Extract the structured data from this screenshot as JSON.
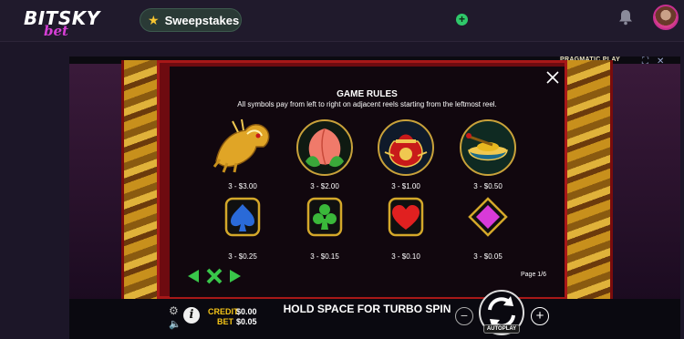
{
  "site": {
    "logo_main": "BITSKY",
    "logo_sub": "bet",
    "sweepstakes_label": "Sweepstakes",
    "add_icon": "plus-icon",
    "notification_icon": "bell-icon",
    "avatar_icon": "user-avatar"
  },
  "game": {
    "provider": "PRAGMATIC PLAY",
    "rules": {
      "title": "GAME RULES",
      "description": "All symbols pay from left to right on adjacent reels starting from the leftmost reel.",
      "symbols": [
        {
          "name": "dragon",
          "pay": "3 - $3.00"
        },
        {
          "name": "peach",
          "pay": "3 - $2.00"
        },
        {
          "name": "lucky-bag",
          "pay": "3 - $1.00"
        },
        {
          "name": "ingot-bowl",
          "pay": "3 - $0.50"
        },
        {
          "name": "spade",
          "pay": "3 - $0.25"
        },
        {
          "name": "club",
          "pay": "3 - $0.15"
        },
        {
          "name": "heart",
          "pay": "3 - $0.10"
        },
        {
          "name": "diamond",
          "pay": "3 - $0.05"
        }
      ],
      "page": "Page 1/6"
    },
    "bottom": {
      "credit_label": "CREDIT",
      "credit_value": "$0.00",
      "bet_label": "BET",
      "bet_value": "$0.05",
      "message": "HOLD SPACE FOR TURBO SPIN",
      "autoplay_label": "AUTOPLAY"
    },
    "colors": {
      "accent_gold": "#f5c518",
      "nav_green": "#39c64a",
      "frame_red": "#a71818"
    }
  }
}
